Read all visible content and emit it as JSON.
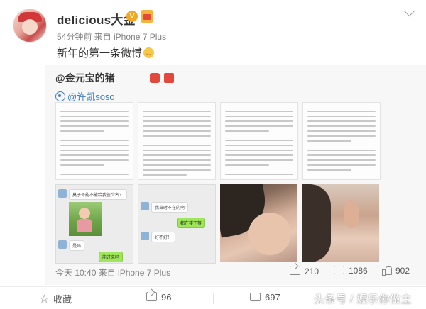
{
  "post": {
    "username": "delicious大金",
    "verified_badge": "V",
    "meta": "54分钟前 来自 iPhone 7 Plus",
    "text": "新年的第一条微博"
  },
  "repost": {
    "author": "@金元宝的猪",
    "mention": "@许凯soso",
    "chat_texts": {
      "c1_msg1": "莫子哥能不能给我签个名？",
      "c1_msg2": "是吗",
      "c1_msg3": "能过来吗",
      "c2_msg1": "我当时不在的啊",
      "c2_msg2": "都在楼下等",
      "c2_msg3": "好不好！"
    },
    "footer": {
      "time": "今天 10:40 来自 iPhone 7 Plus",
      "shares": "210",
      "comments": "1086",
      "likes": "902"
    }
  },
  "actions": {
    "favorite": "收藏",
    "shares": "96",
    "comments": "697"
  },
  "watermark": "头条号 / 娱乐你做主",
  "colors": {
    "link": "#3f7ec5",
    "repost_bg": "#f7f7f7",
    "badge_orange": "#f5a623"
  }
}
